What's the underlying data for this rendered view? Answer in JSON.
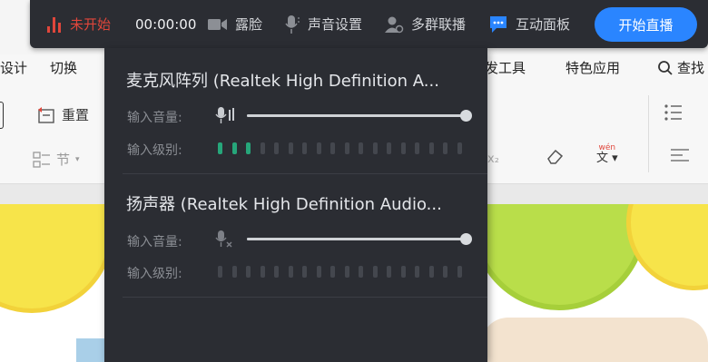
{
  "ribbon": {
    "tabs": [
      "设计",
      "切换",
      "发工具",
      "特色应用",
      "查找"
    ],
    "reset_label": "重置",
    "section_label": "节"
  },
  "toolbar": {
    "status": "未开始",
    "timer": "00:00:00",
    "camera": "露脸",
    "sound": "声音设置",
    "multi_group": "多群联播",
    "interactive": "互动面板",
    "start_live": "开始直播"
  },
  "audio_panel": {
    "mic": {
      "title": "麦克风阵列 (Realtek High Definition A...",
      "input_volume_label": "输入音量:",
      "input_level_label": "输入级别:",
      "volume": 1.0,
      "level_active": 3,
      "level_total": 18
    },
    "speaker": {
      "title": "扬声器 (Realtek High Definition Audio...",
      "input_volume_label": "输入音量:",
      "input_level_label": "输入级别:",
      "volume": 1.0,
      "level_active": 0,
      "level_total": 18
    }
  },
  "colors": {
    "toolbar_bg": "#2b2d33",
    "status_red": "#e0463b",
    "primary_blue": "#2a85ff",
    "level_green": "#26a67a"
  }
}
